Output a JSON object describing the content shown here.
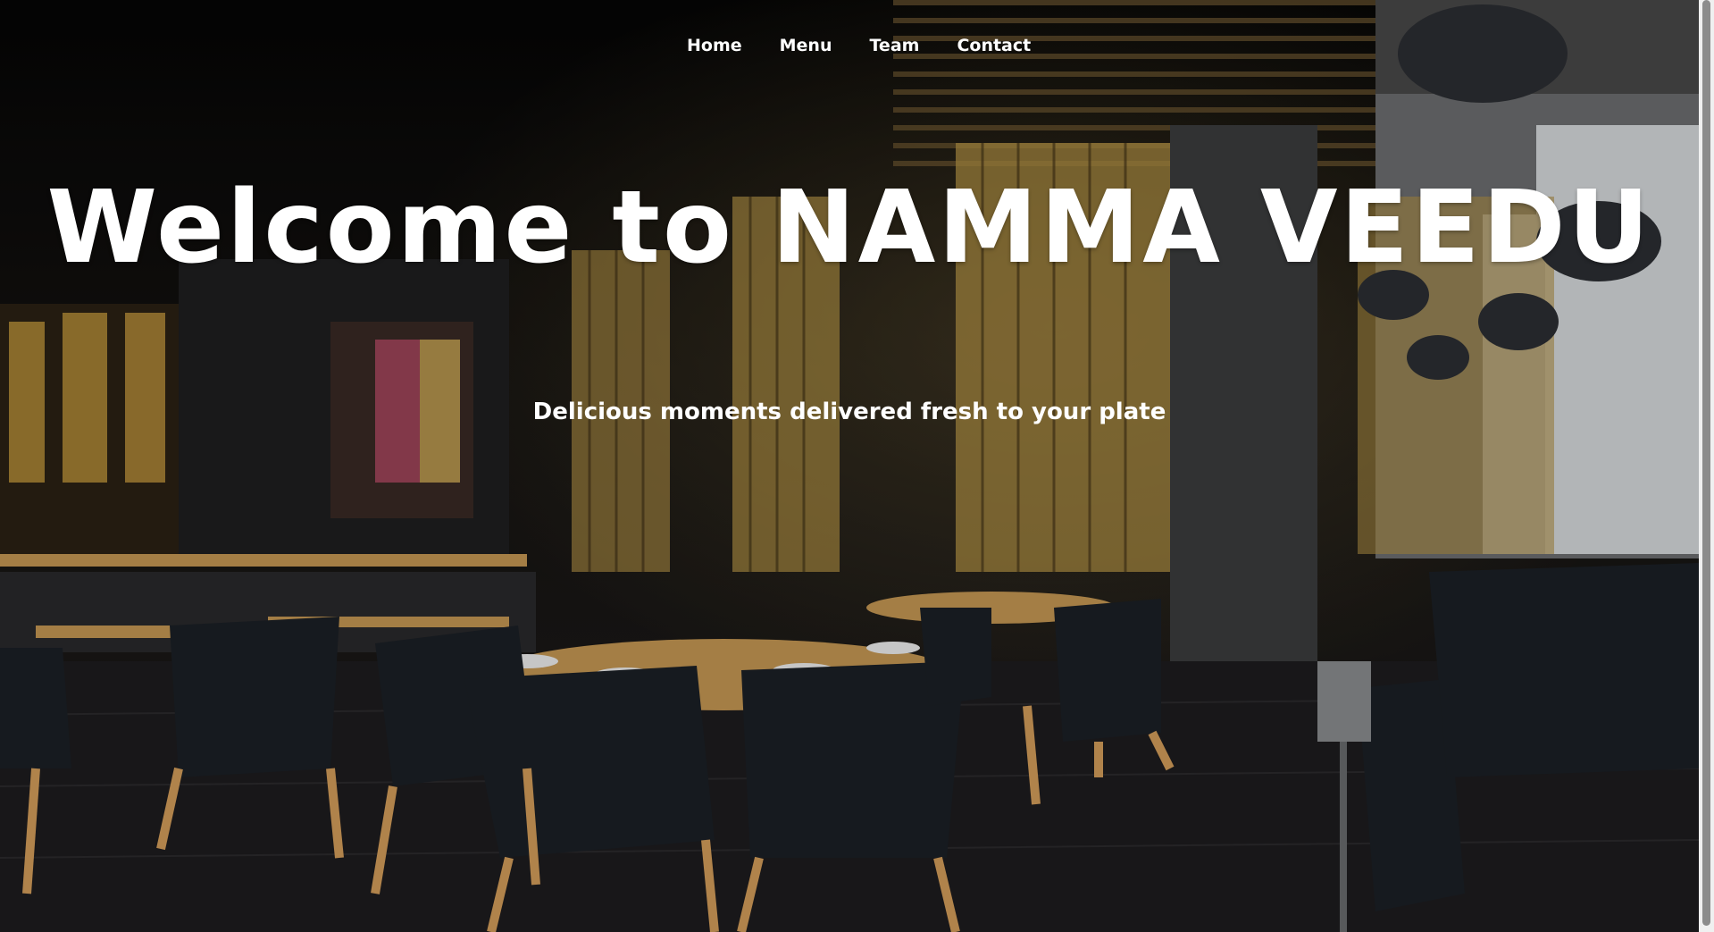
{
  "nav": {
    "items": [
      {
        "label": "Home"
      },
      {
        "label": "Menu"
      },
      {
        "label": "Team"
      },
      {
        "label": "Contact"
      }
    ]
  },
  "hero": {
    "title": "Welcome to NAMMA VEEDU",
    "subtitle": "Delicious moments delivered fresh to your plate"
  },
  "background": {
    "image": "restaurant-interior-photo",
    "colors": {
      "wood": "#c99a55",
      "chair": "#1c2026",
      "floor": "#1e1d1f",
      "gold_screen": "#b59446"
    }
  }
}
